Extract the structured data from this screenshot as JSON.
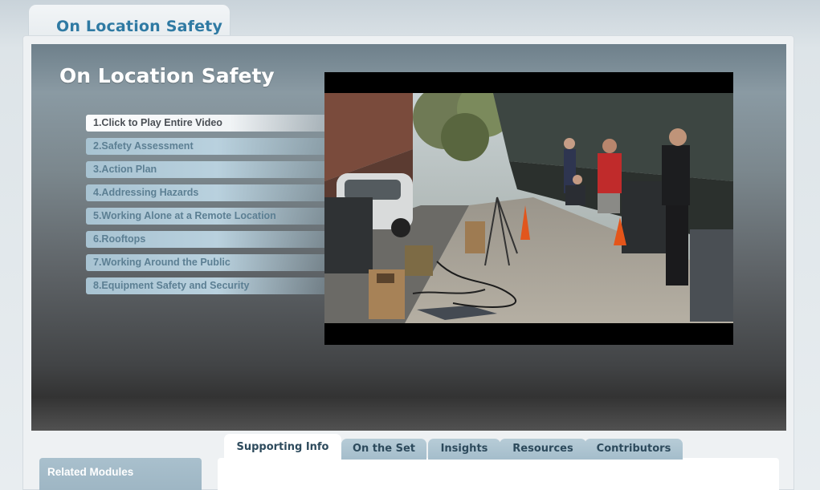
{
  "header": {
    "tab_label": "On Location Safety"
  },
  "stage": {
    "title": "On Location Safety"
  },
  "chapters": [
    {
      "label": "1.Click to Play Entire Video",
      "active": true
    },
    {
      "label": "2.Safety Assessment",
      "active": false
    },
    {
      "label": "3.Action Plan",
      "active": false
    },
    {
      "label": "4.Addressing Hazards",
      "active": false
    },
    {
      "label": "5.Working Alone at a Remote Location",
      "active": false
    },
    {
      "label": "6.Rooftops",
      "active": false
    },
    {
      "label": "7.Working Around the Public",
      "active": false
    },
    {
      "label": "8.Equipment Safety and Security",
      "active": false
    }
  ],
  "tabs": [
    {
      "label": "Supporting Info",
      "active": true
    },
    {
      "label": "On the Set",
      "active": false
    },
    {
      "label": "Insights",
      "active": false
    },
    {
      "label": "Resources",
      "active": false
    },
    {
      "label": "Contributors",
      "active": false
    }
  ],
  "sidebar": {
    "related_label": "Related Modules"
  },
  "colors": {
    "accent": "#2f7aa3",
    "chapter_text": "#5c7f93",
    "tab_text": "#2d4a5c"
  }
}
